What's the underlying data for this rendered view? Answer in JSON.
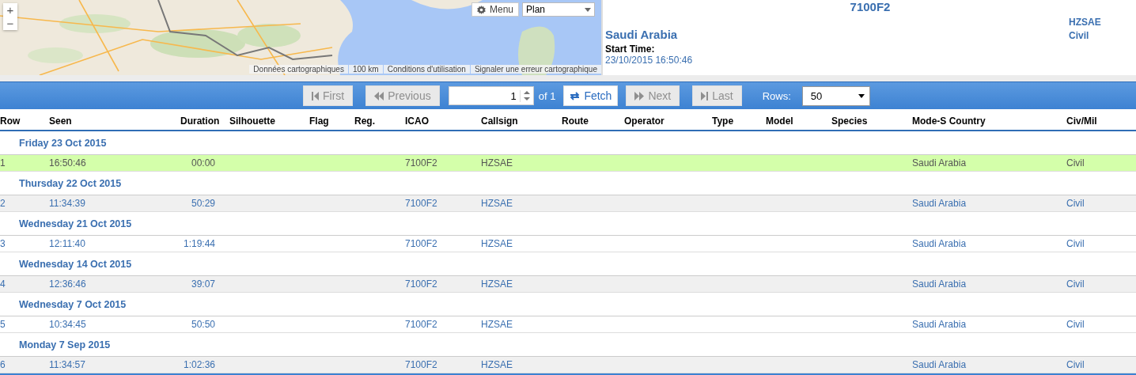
{
  "map": {
    "zoom_in": "+",
    "zoom_out": "−",
    "menu": "Menu",
    "map_type": "Plan",
    "attribution": [
      "Données cartographiques",
      "100 km",
      "Conditions d'utilisation",
      "Signaler une erreur cartographique"
    ]
  },
  "detail": {
    "icao": "7100F2",
    "country": "Saudi Arabia",
    "start_time_label": "Start Time:",
    "start_time": "23/10/2015 16:50:46",
    "callsign": "HZSAE",
    "civ_mil": "Civil"
  },
  "pager": {
    "buttons": [
      {
        "kind": "first",
        "label": "First",
        "disabled": true
      },
      {
        "kind": "previous",
        "label": "Previous",
        "disabled": true
      },
      {
        "kind": "page",
        "label": "of 1"
      },
      {
        "kind": "fetch",
        "label": "Fetch",
        "disabled": false
      },
      {
        "kind": "next",
        "label": "Next",
        "disabled": true
      },
      {
        "kind": "last",
        "label": "Last",
        "disabled": true
      }
    ],
    "page": "1",
    "rows_label": "Rows:",
    "rows": "50"
  },
  "table": {
    "columns": [
      "Row",
      "Seen",
      "Duration",
      "Silhouette",
      "Flag",
      "Reg.",
      "ICAO",
      "Callsign",
      "Route",
      "Operator",
      "Type",
      "Model",
      "Species",
      "Mode-S Country",
      "Civ/Mil"
    ],
    "groups": [
      {
        "date": "Friday 23 Oct 2015",
        "rows": [
          {
            "row": "1",
            "seen": "16:50:46",
            "duration": "00:00",
            "icao": "7100F2",
            "callsign": "HZSAE",
            "country": "Saudi Arabia",
            "civ_mil": "Civil",
            "selected": true
          }
        ]
      },
      {
        "date": "Thursday 22 Oct 2015",
        "rows": [
          {
            "row": "2",
            "seen": "11:34:39",
            "duration": "50:29",
            "icao": "7100F2",
            "callsign": "HZSAE",
            "country": "Saudi Arabia",
            "civ_mil": "Civil",
            "selected": false
          }
        ]
      },
      {
        "date": "Wednesday 21 Oct 2015",
        "rows": [
          {
            "row": "3",
            "seen": "12:11:40",
            "duration": "1:19:44",
            "icao": "7100F2",
            "callsign": "HZSAE",
            "country": "Saudi Arabia",
            "civ_mil": "Civil",
            "selected": false
          }
        ]
      },
      {
        "date": "Wednesday 14 Oct 2015",
        "rows": [
          {
            "row": "4",
            "seen": "12:36:46",
            "duration": "39:07",
            "icao": "7100F2",
            "callsign": "HZSAE",
            "country": "Saudi Arabia",
            "civ_mil": "Civil",
            "selected": false
          }
        ]
      },
      {
        "date": "Wednesday 7 Oct 2015",
        "rows": [
          {
            "row": "5",
            "seen": "10:34:45",
            "duration": "50:50",
            "icao": "7100F2",
            "callsign": "HZSAE",
            "country": "Saudi Arabia",
            "civ_mil": "Civil",
            "selected": false
          }
        ]
      },
      {
        "date": "Monday 7 Sep 2015",
        "rows": [
          {
            "row": "6",
            "seen": "11:34:57",
            "duration": "1:02:36",
            "icao": "7100F2",
            "callsign": "HZSAE",
            "country": "Saudi Arabia",
            "civ_mil": "Civil",
            "selected": false
          }
        ]
      }
    ]
  }
}
